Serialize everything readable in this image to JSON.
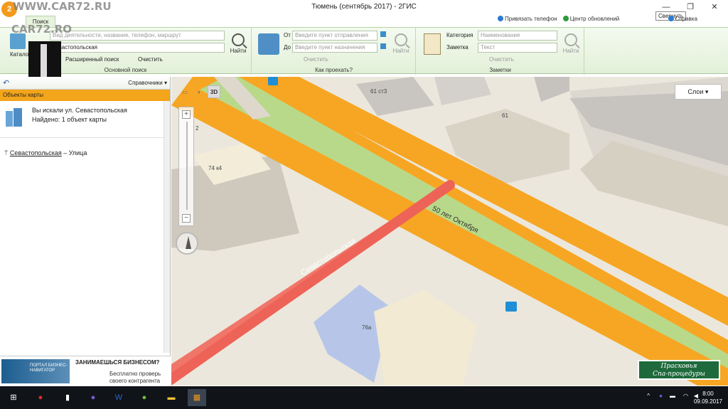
{
  "window": {
    "title": "Тюмень (сентябрь 2017) - 2ГИС",
    "minimize_tooltip": "Свернуть",
    "controls": [
      "—",
      "❐",
      "✕"
    ]
  },
  "watermark": {
    "top": "WWW.CAR72.RU",
    "left": "CAR72.RO"
  },
  "app": {
    "logo": "2",
    "tab": "Поиск"
  },
  "top_links": [
    {
      "label": "Привязать телефон",
      "color": "#2b7bd1"
    },
    {
      "label": "Центр обновлений",
      "color": "#2b9b3c"
    },
    {
      "label": "Справка",
      "color": "#2b7bd1"
    }
  ],
  "ribbon": {
    "basic_search": {
      "catalog": "Каталог",
      "placeholder": "Вид деятельности, название, телефон, маршрут",
      "value": "севастопольская",
      "find": "Найти",
      "advanced": "Расширенный поиск",
      "clear": "Очистить",
      "group_label": "Основной поиск"
    },
    "route": {
      "from_label": "От",
      "to_label": "До",
      "from_placeholder": "Введите пункт отправления",
      "to_placeholder": "Введите пункт назначения",
      "clear": "Очистить",
      "find": "Найти",
      "group_label": "Как проехать?"
    },
    "notes": {
      "category_label": "Категория",
      "note_label": "Заметка",
      "category_placeholder": "Наименование",
      "text_placeholder": "Текст",
      "clear": "Очистить",
      "find": "Найти",
      "group_label": "Заметки"
    }
  },
  "overlay_slider": {
    "value": "5",
    "level": 0.17
  },
  "left_panel": {
    "directories": "Справочники ▾",
    "tab": "Объекты карты",
    "result_title": "Вы искали ул. Севастопольская",
    "result_found": "Найдено: 1 объект карты",
    "item_name": "Севастопольская",
    "item_type": " – Улица"
  },
  "ad": {
    "portal": "ПОРТАЛ БИЗНЕС-НАВИГАТОР",
    "headline": "ЗАНИМАЕШЬСЯ БИЗНЕСОМ?",
    "line1": "Бесплатно проверь",
    "line2": "своего контрагента"
  },
  "map": {
    "layers": "Слои ▾",
    "mode_3d": "3D",
    "street_main": "Севастопольская",
    "street_cross": "50 лет Октября",
    "labels": {
      "b1": "61 ст3",
      "b2": "61",
      "b3": "74 к4",
      "b4": "76а",
      "b5": "2"
    },
    "ad_line1": "Прасковья",
    "ad_line2": "Спа-процедуры"
  },
  "taskbar": {
    "time": "8:00",
    "date": "09.09.2017",
    "start_icon": "windows-icon"
  }
}
